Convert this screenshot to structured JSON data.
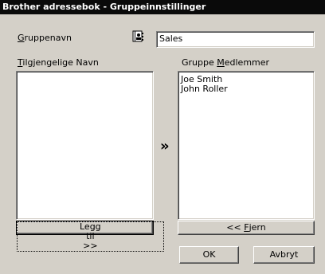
{
  "window": {
    "title": "Brother adressebok - Gruppeinnstillinger"
  },
  "group_name": {
    "label": "Gruppenavn",
    "label_accel": "G",
    "label_rest": "ruppenavn",
    "value": "Sales",
    "icon": "address-book-icon"
  },
  "available": {
    "label": "Tilgjengelige Navn",
    "label_accel": "T",
    "label_rest": "ilgjengelige Navn",
    "items": []
  },
  "members": {
    "label": "Gruppe Medlemmer",
    "label_pre": "Gruppe ",
    "label_accel": "M",
    "label_rest": "edlemmer",
    "items": [
      "Joe Smith",
      "John Roller"
    ]
  },
  "arrow": {
    "glyph": "»"
  },
  "buttons": {
    "add": "Legg til >>",
    "remove_pre": "<< ",
    "remove_accel": "F",
    "remove_rest": "jern",
    "ok": "OK",
    "cancel": "Avbryt"
  }
}
